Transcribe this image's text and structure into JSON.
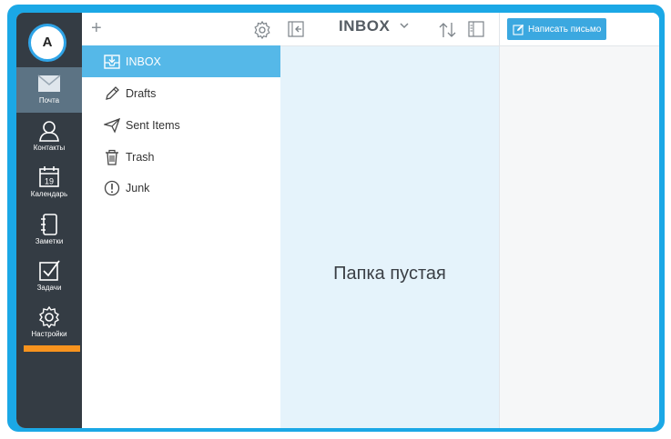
{
  "user": {
    "avatar_initial": "A"
  },
  "rail": {
    "items": [
      {
        "id": "mail",
        "label": "Почта",
        "icon": "mail-icon",
        "active": true
      },
      {
        "id": "contacts",
        "label": "Контакты",
        "icon": "person-icon"
      },
      {
        "id": "calendar",
        "label": "Календарь",
        "icon": "calendar-icon",
        "day": "19"
      },
      {
        "id": "notes",
        "label": "Заметки",
        "icon": "notebook-icon"
      },
      {
        "id": "tasks",
        "label": "Задачи",
        "icon": "checkbox-icon"
      },
      {
        "id": "settings",
        "label": "Настройки",
        "icon": "gear-icon"
      }
    ]
  },
  "folders": {
    "items": [
      {
        "label": "INBOX",
        "icon": "inbox-icon",
        "active": true
      },
      {
        "label": "Drafts",
        "icon": "pencil-icon"
      },
      {
        "label": "Sent Items",
        "icon": "paper-plane-icon"
      },
      {
        "label": "Trash",
        "icon": "trash-icon"
      },
      {
        "label": "Junk",
        "icon": "exclamation-circle-icon"
      }
    ]
  },
  "list": {
    "title": "INBOX",
    "empty_text": "Папка пустая"
  },
  "reader": {
    "compose_label": "Написать письмо"
  },
  "colors": {
    "accent": "#1ba8e6",
    "rail_bg": "#343c44",
    "rail_active": "#5c7384",
    "folder_active": "#55b8e8",
    "highlight": "#f7931e",
    "list_bg": "#e5f3fb"
  }
}
